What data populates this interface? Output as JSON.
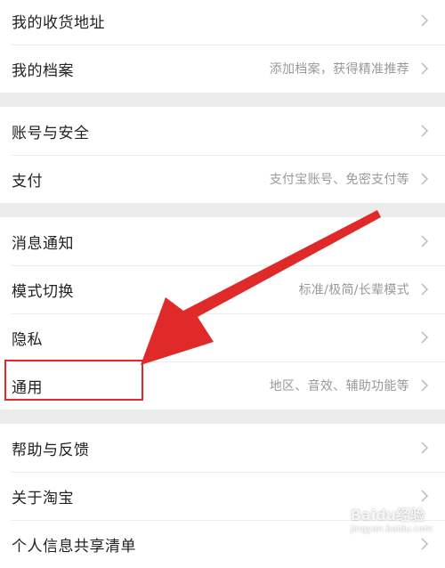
{
  "groups": [
    {
      "rows": [
        {
          "label": "我的收货地址",
          "hint": ""
        },
        {
          "label": "我的档案",
          "hint": "添加档案，获得精准推荐"
        }
      ]
    },
    {
      "rows": [
        {
          "label": "账号与安全",
          "hint": ""
        },
        {
          "label": "支付",
          "hint": "支付宝账号、免密支付等"
        }
      ]
    },
    {
      "rows": [
        {
          "label": "消息通知",
          "hint": ""
        },
        {
          "label": "模式切换",
          "hint": "标准/极简/长辈模式"
        },
        {
          "label": "隐私",
          "hint": ""
        },
        {
          "label": "通用",
          "hint": "地区、音效、辅助功能等"
        }
      ]
    },
    {
      "rows": [
        {
          "label": "帮助与反馈",
          "hint": ""
        },
        {
          "label": "关于淘宝",
          "hint": ""
        },
        {
          "label": "个人信息共享清单",
          "hint": ""
        }
      ]
    }
  ],
  "annotation": {
    "color": "#e02a2a",
    "target": "通用"
  },
  "watermark": {
    "brand": "Baidu经验",
    "url": "jingyan.baidu.com"
  },
  "colors": {
    "background": "#f2f2f2",
    "row": "#ffffff",
    "text": "#222222",
    "hint": "#999999",
    "accent": "#e02a2a"
  }
}
